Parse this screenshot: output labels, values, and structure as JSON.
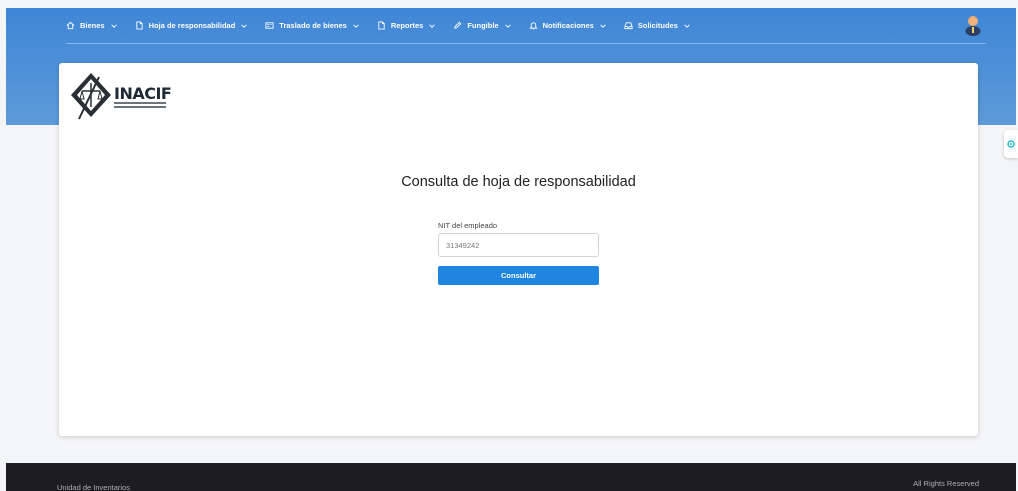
{
  "nav": {
    "items": [
      {
        "label": "Bienes",
        "icon": "home-icon"
      },
      {
        "label": "Hoja de responsabilidad",
        "icon": "file-icon"
      },
      {
        "label": "Traslado de bienes",
        "icon": "card-icon"
      },
      {
        "label": "Reportes",
        "icon": "file-icon"
      },
      {
        "label": "Fungible",
        "icon": "pencil-icon"
      },
      {
        "label": "Notificaciones",
        "icon": "bell-icon"
      },
      {
        "label": "Solicitudes",
        "icon": "inbox-icon"
      }
    ]
  },
  "logo": {
    "text": "INACIF"
  },
  "form": {
    "title": "Consulta de hoja de responsabilidad",
    "nit_label": "NIT del empleado",
    "nit_value": "31349242",
    "submit_label": "Consultar"
  },
  "footer": {
    "left": "Unidad de Inventarios",
    "right": "All Rights Reserved"
  },
  "colors": {
    "header_blue": "#3f86d6",
    "button_blue": "#1e86e0",
    "footer_bg": "#1d1d1f"
  }
}
